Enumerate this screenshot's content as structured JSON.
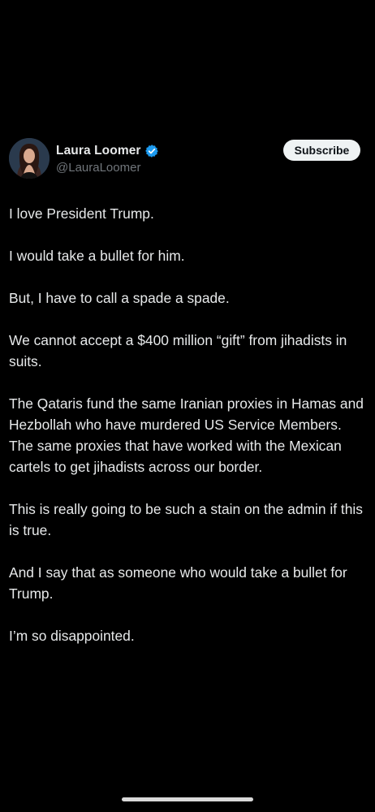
{
  "author": {
    "display_name": "Laura Loomer",
    "handle": "@LauraLoomer",
    "verified": true,
    "verified_icon": "verified-badge-icon",
    "verified_color": "#1d9bf0"
  },
  "actions": {
    "subscribe_label": "Subscribe"
  },
  "post": {
    "paragraphs": [
      "I love President Trump.",
      "I would take a bullet for him.",
      "But, I have to call a spade a spade.",
      "We cannot accept a $400 million “gift” from jihadists in suits.",
      "The Qataris fund the same Iranian proxies in Hamas and Hezbollah who have murdered US Service Members. The same proxies that have worked with the Mexican cartels to get jihadists across our border.",
      "This is really going to be such a stain on the admin if this is true.",
      "And I say that as someone who would take a bullet for Trump.",
      "I’m so disappointed."
    ]
  },
  "colors": {
    "background": "#000000",
    "text_primary": "#e7e9ea",
    "text_secondary": "#71767b",
    "button_bg": "#eff3f4"
  }
}
